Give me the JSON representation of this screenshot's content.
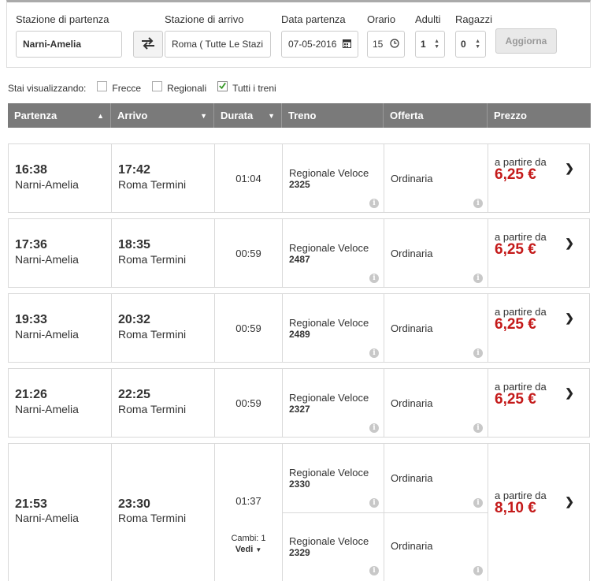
{
  "search": {
    "departure_label": "Stazione di partenza",
    "departure_value": "Narni-Amelia",
    "arrival_label": "Stazione di arrivo",
    "arrival_value": "Roma ( Tutte Le Stazi",
    "date_label": "Data partenza",
    "date_value": "07-05-2016",
    "time_label": "Orario",
    "time_value": "15",
    "adults_label": "Adulti",
    "adults_value": "1",
    "children_label": "Ragazzi",
    "children_value": "0",
    "update_label": "Aggiorna"
  },
  "filters": {
    "label": "Stai visualizzando:",
    "options": [
      {
        "label": "Frecce",
        "checked": false
      },
      {
        "label": "Regionali",
        "checked": false
      },
      {
        "label": "Tutti i treni",
        "checked": true
      }
    ]
  },
  "columns": [
    "Partenza",
    "Arrivo",
    "Durata",
    "Treno",
    "Offerta",
    "Prezzo"
  ],
  "results": [
    {
      "dep_time": "16:38",
      "dep_station": "Narni-Amelia",
      "arr_time": "17:42",
      "arr_station": "Roma Termini",
      "duration": "01:04",
      "trains": [
        {
          "name": "Regionale Veloce",
          "number": "2325",
          "offer": "Ordinaria"
        }
      ],
      "price_prefix": "a partire da",
      "price": "6,25 €"
    },
    {
      "dep_time": "17:36",
      "dep_station": "Narni-Amelia",
      "arr_time": "18:35",
      "arr_station": "Roma Termini",
      "duration": "00:59",
      "trains": [
        {
          "name": "Regionale Veloce",
          "number": "2487",
          "offer": "Ordinaria"
        }
      ],
      "price_prefix": "a partire da",
      "price": "6,25 €"
    },
    {
      "dep_time": "19:33",
      "dep_station": "Narni-Amelia",
      "arr_time": "20:32",
      "arr_station": "Roma Termini",
      "duration": "00:59",
      "trains": [
        {
          "name": "Regionale Veloce",
          "number": "2489",
          "offer": "Ordinaria"
        }
      ],
      "price_prefix": "a partire da",
      "price": "6,25 €"
    },
    {
      "dep_time": "21:26",
      "dep_station": "Narni-Amelia",
      "arr_time": "22:25",
      "arr_station": "Roma Termini",
      "duration": "00:59",
      "trains": [
        {
          "name": "Regionale Veloce",
          "number": "2327",
          "offer": "Ordinaria"
        }
      ],
      "price_prefix": "a partire da",
      "price": "6,25 €"
    },
    {
      "dep_time": "21:53",
      "dep_station": "Narni-Amelia",
      "arr_time": "23:30",
      "arr_station": "Roma Termini",
      "duration": "01:37",
      "changes": "Cambi: 1",
      "details_label": "Vedi",
      "trains": [
        {
          "name": "Regionale Veloce",
          "number": "2330",
          "offer": "Ordinaria"
        },
        {
          "name": "Regionale Veloce",
          "number": "2329",
          "offer": "Ordinaria"
        }
      ],
      "price_prefix": "a partire da",
      "price": "8,10 €"
    }
  ],
  "icons": {
    "swap": "swap-arrows-icon",
    "calendar": "calendar-icon",
    "clock": "clock-icon",
    "info": "info-icon",
    "chevron": "chevron-right-icon"
  },
  "colors": {
    "header_bg": "#7a7a7a",
    "price": "#c41a1a",
    "checkmark": "#3a9a2a"
  }
}
